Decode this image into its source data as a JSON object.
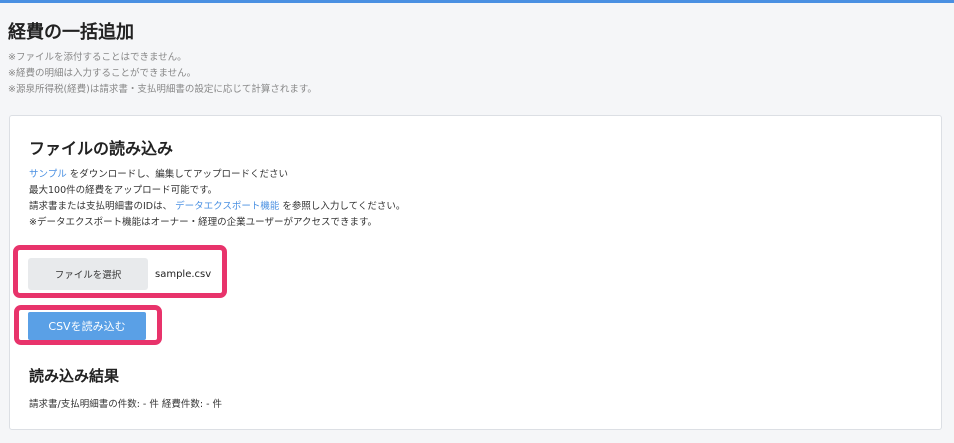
{
  "page": {
    "title": "経費の一括追加",
    "notes": [
      "※ファイルを添付することはできません。",
      "※経費の明細は入力することができません。",
      "※源泉所得税(経費)は請求書・支払明細書の設定に応じて計算されます。"
    ]
  },
  "import": {
    "title": "ファイルの読み込み",
    "line1_link": "サンプル",
    "line1_text": "をダウンロードし、編集してアップロードください",
    "line2": "最大100件の経費をアップロード可能です。",
    "line3_prefix": "請求書または支払明細書のIDは、",
    "line3_link": "データエクスポート機能",
    "line3_suffix": "を参照し入力してください。",
    "line4": "※データエクスポート機能はオーナー・経理の企業ユーザーがアクセスできます。",
    "file_button_label": "ファイルを選択",
    "file_name": "sample.csv",
    "load_button_label": "CSVを読み込む"
  },
  "result": {
    "title": "読み込み結果",
    "summary": "請求書/支払明細書の件数: - 件 経費件数: - 件"
  },
  "colors": {
    "accent": "#4a90e2",
    "button_primary": "#5aa0e6",
    "highlight": "#e8336b"
  }
}
